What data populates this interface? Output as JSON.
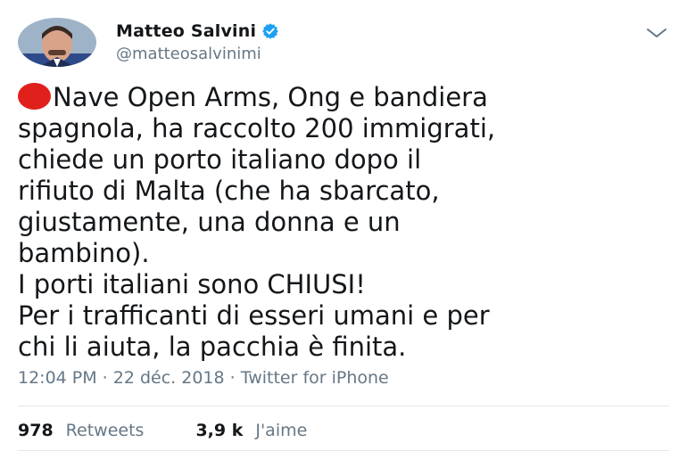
{
  "tweet": {
    "display_name": "Matteo Salvini",
    "handle": "@matteosalvinimi",
    "verified_icon": "verified-badge-icon",
    "menu_icon": "chevron-down-icon",
    "emoji": "red-circle",
    "text": "Nave Open Arms, Ong e bandiera\nspagnola, ha raccolto 200 immigrati,\nchiede un porto italiano dopo il\nrifiuto di Malta (che ha sbarcato,\ngiustamente, una donna e un\nbambino).\nI porti italiani sono CHIUSI!\nPer i trafficanti di esseri umani e per\nchi li aiuta, la pacchia è finita.",
    "meta": "12:04 PM · 22 déc. 2018 · Twitter for iPhone",
    "retweets_count": "978",
    "retweets_label": "Retweets",
    "likes_count": "3,9 k",
    "likes_label": "J'aime"
  },
  "colors": {
    "text": "#14171a",
    "secondary": "#657786",
    "verified": "#1da1f2",
    "red_circle": "#e0201b",
    "divider": "#e1e8ed"
  }
}
